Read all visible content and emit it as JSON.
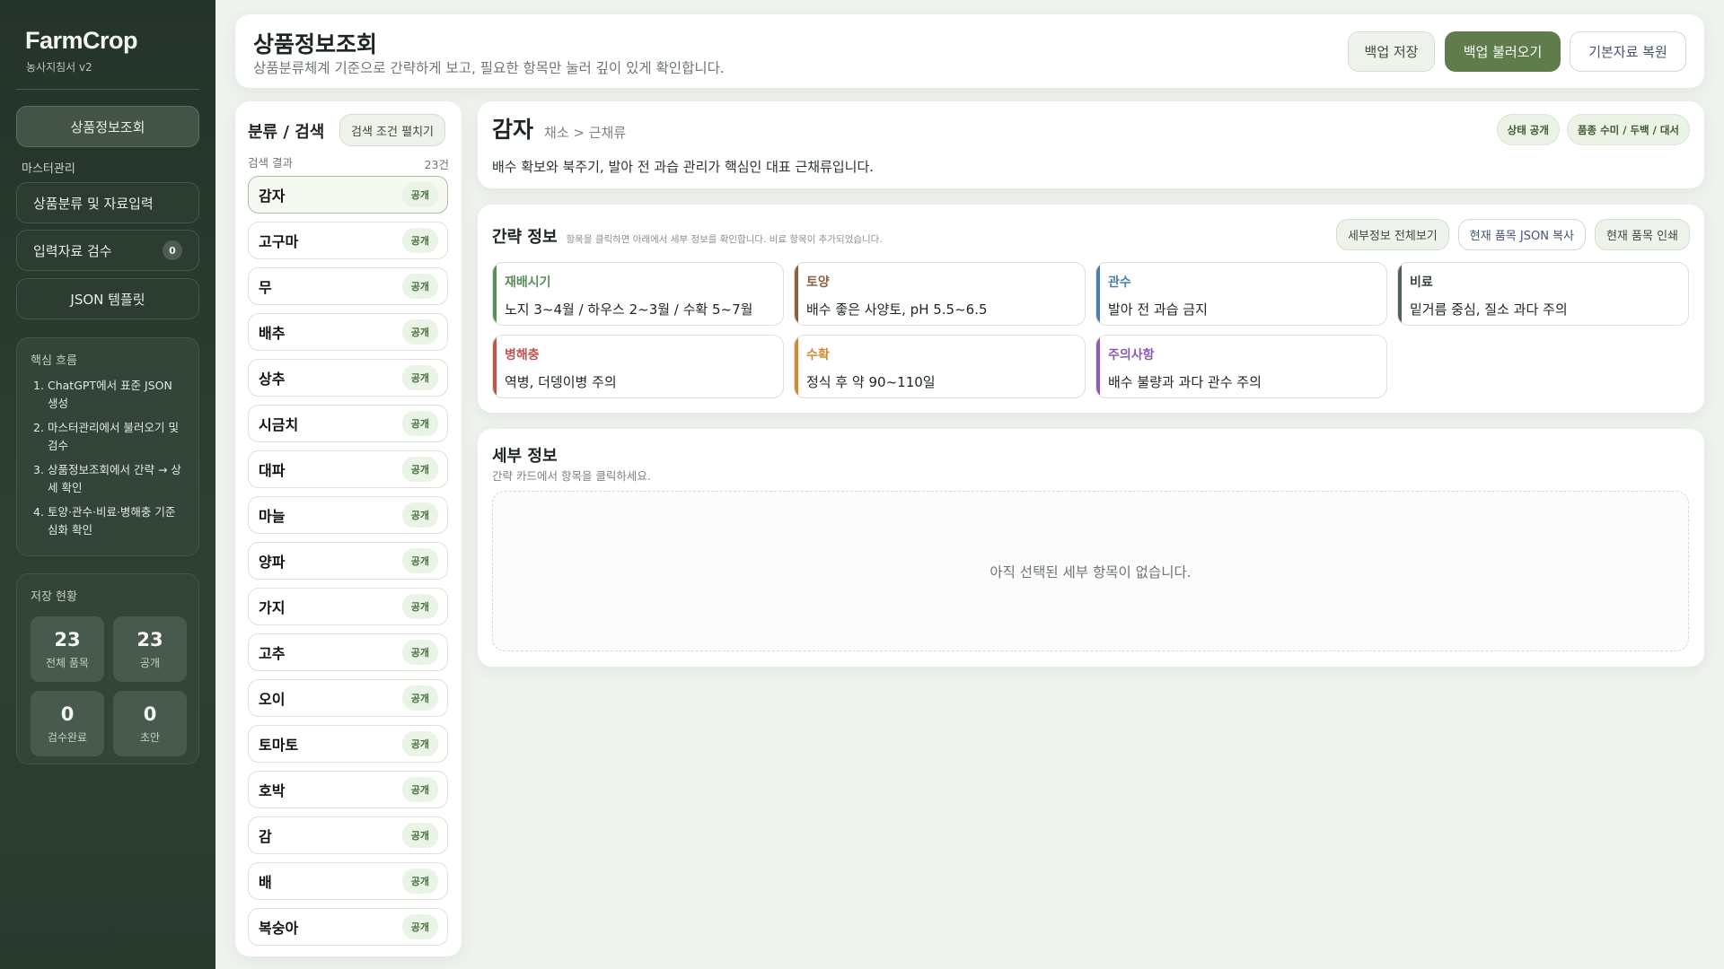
{
  "sidebar": {
    "brand": "FarmCrop",
    "subtitle": "농사지침서 v2",
    "nav_main": "상품정보조회",
    "section_label": "마스터관리",
    "nav_items": [
      {
        "label": "상품분류 및 자료입력"
      },
      {
        "label": "입력자료 검수",
        "badge": "0"
      },
      {
        "label": "JSON 템플릿"
      }
    ],
    "flow": {
      "title": "핵심 흐름",
      "steps": [
        {
          "n": "1.",
          "text": "ChatGPT에서 표준 JSON 생성"
        },
        {
          "n": "2.",
          "text": "마스터관리에서 불러오기 및 검수"
        },
        {
          "n": "3.",
          "text": "상품정보조회에서 간략 → 상세 확인"
        },
        {
          "n": "4.",
          "text": "토양·관수·비료·병해충 기준 심화 확인"
        }
      ]
    },
    "stats": {
      "title": "저장 현황",
      "items": [
        {
          "value": "23",
          "label": "전체 품목"
        },
        {
          "value": "23",
          "label": "공개"
        },
        {
          "value": "0",
          "label": "검수완료"
        },
        {
          "value": "0",
          "label": "초안"
        }
      ]
    }
  },
  "header": {
    "title": "상품정보조회",
    "subtitle": "상품분류체계 기준으로 간략하게 보고, 필요한 항목만 눌러 깊이 있게 확인합니다.",
    "buttons": {
      "save": "백업 저장",
      "load": "백업 불러오기",
      "restore": "기본자료 복원"
    }
  },
  "search": {
    "title": "분류 / 검색",
    "expand_button": "검색 조건 펼치기",
    "result_label": "검색 결과",
    "result_count": "23건",
    "items": [
      {
        "name": "감자",
        "status": "공개"
      },
      {
        "name": "고구마",
        "status": "공개"
      },
      {
        "name": "무",
        "status": "공개"
      },
      {
        "name": "배추",
        "status": "공개"
      },
      {
        "name": "상추",
        "status": "공개"
      },
      {
        "name": "시금치",
        "status": "공개"
      },
      {
        "name": "대파",
        "status": "공개"
      },
      {
        "name": "마늘",
        "status": "공개"
      },
      {
        "name": "양파",
        "status": "공개"
      },
      {
        "name": "가지",
        "status": "공개"
      },
      {
        "name": "고추",
        "status": "공개"
      },
      {
        "name": "오이",
        "status": "공개"
      },
      {
        "name": "토마토",
        "status": "공개"
      },
      {
        "name": "호박",
        "status": "공개"
      },
      {
        "name": "감",
        "status": "공개"
      },
      {
        "name": "배",
        "status": "공개"
      },
      {
        "name": "복숭아",
        "status": "공개"
      }
    ]
  },
  "product": {
    "name": "감자",
    "breadcrumb": "채소 > 근채류",
    "status_chip": "상태 공개",
    "variety_chip": "품종 수미 / 두백 / 대서",
    "description": "배수 확보와 북주기, 발아 전 과습 관리가 핵심인 대표 근채류입니다."
  },
  "brief": {
    "title": "간략 정보",
    "hint": "항목을 클릭하면 아래에서 세부 정보를 확인합니다. 비료 항목이 추가되었습니다.",
    "buttons": {
      "view_all": "세부정보 전체보기",
      "copy_json": "현재 품목 JSON 복사",
      "print": "현재 품목 인쇄"
    },
    "cards": [
      {
        "title": "재배시기",
        "text": "노지 3~4월 / 하우스 2~3월 / 수확 5~7월",
        "color": "#5b8c5a"
      },
      {
        "title": "토양",
        "text": "배수 좋은 사양토, pH 5.5~6.5",
        "color": "#8a6242"
      },
      {
        "title": "관수",
        "text": "발아 전 과습 금지",
        "color": "#4a7db3"
      },
      {
        "title": "비료",
        "text": "밑거름 중심, 질소 과다 주의",
        "color": "#55605a"
      },
      {
        "title": "병해충",
        "text": "역병, 더뎅이병 주의",
        "color": "#c25450"
      },
      {
        "title": "수확",
        "text": "정식 후 약 90~110일",
        "color": "#d18a32"
      },
      {
        "title": "주의사항",
        "text": "배수 불량과 과다 관수 주의",
        "color": "#8a5cb5"
      }
    ]
  },
  "detail": {
    "title": "세부 정보",
    "hint": "간략 카드에서 항목을 클릭하세요.",
    "empty": "아직 선택된 세부 항목이 없습니다."
  }
}
